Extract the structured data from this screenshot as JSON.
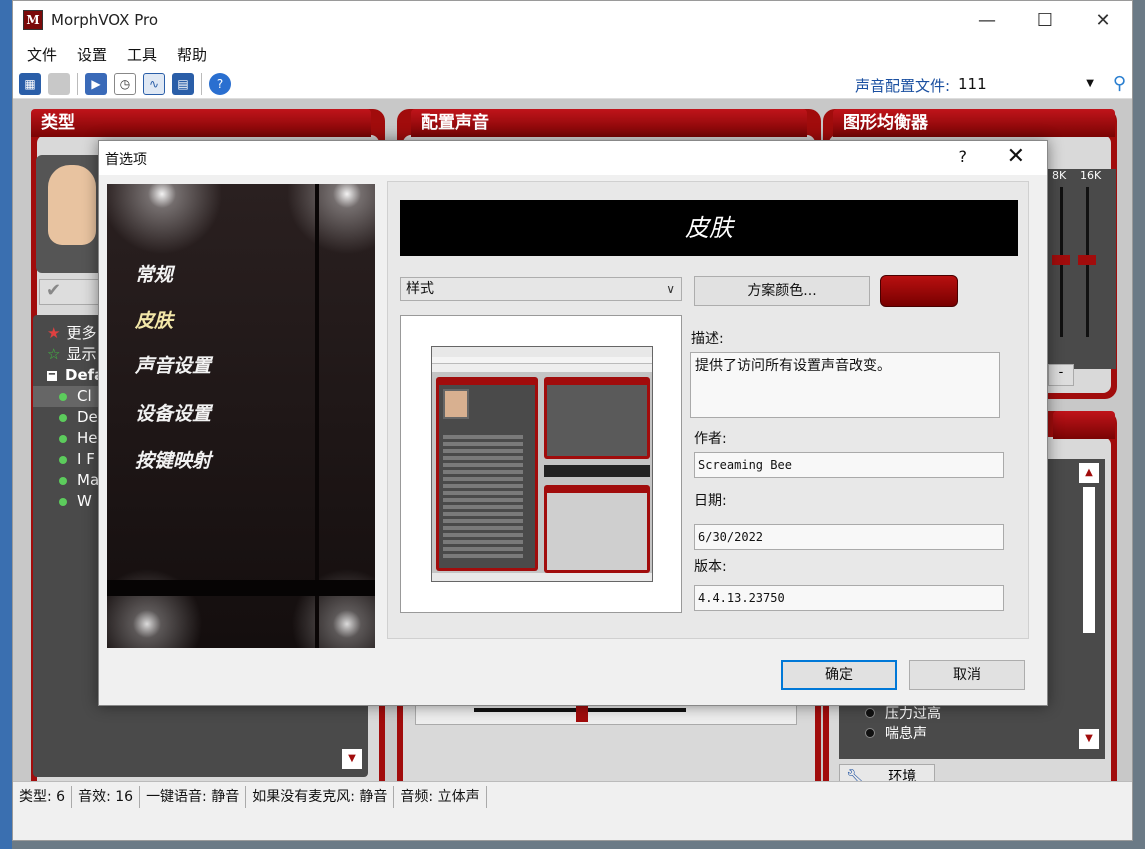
{
  "app": {
    "title": "MorphVOX Pro",
    "icon_letter": "M",
    "minimize": "—",
    "maximize": "☐",
    "close": "✕"
  },
  "menu": [
    "文件",
    "设置",
    "工具",
    "帮助"
  ],
  "toolbar": {
    "profile_label": "声音配置文件:",
    "profile_value": "111"
  },
  "panels": {
    "voice": "类型",
    "tweak": "配置声音",
    "eq": "图形均衡器"
  },
  "voice_list": {
    "more": "更多",
    "show": "显示",
    "group": "Defa",
    "items": [
      "Cl",
      "De",
      "He",
      "I F",
      "Ma",
      "W"
    ]
  },
  "eq": {
    "bands": [
      "8K",
      "16K"
    ]
  },
  "effects": {
    "items": [
      "压力过高",
      "喘息声"
    ],
    "env_button": "环境"
  },
  "statusbar": [
    "类型: 6",
    "音效: 16",
    "一键语音: 静音",
    "如果没有麦克风: 静音",
    "音频: 立体声"
  ],
  "dialog": {
    "title": "首选项",
    "help": "?",
    "close": "✕",
    "nav": [
      "常规",
      "皮肤",
      "声音设置",
      "设备设置",
      "按键映射"
    ],
    "active_nav": 1,
    "banner": "皮肤",
    "style_select": "样式",
    "scheme_button": "方案颜色...",
    "scheme_color": "#a10c0c",
    "desc_label": "描述:",
    "desc_value": "提供了访问所有设置声音改变。",
    "author_label": "作者:",
    "author_value": "Screaming Bee",
    "date_label": "日期:",
    "date_value": "6/30/2022",
    "version_label": "版本:",
    "version_value": "4.4.13.23750",
    "ok": "确定",
    "cancel": "取消"
  }
}
